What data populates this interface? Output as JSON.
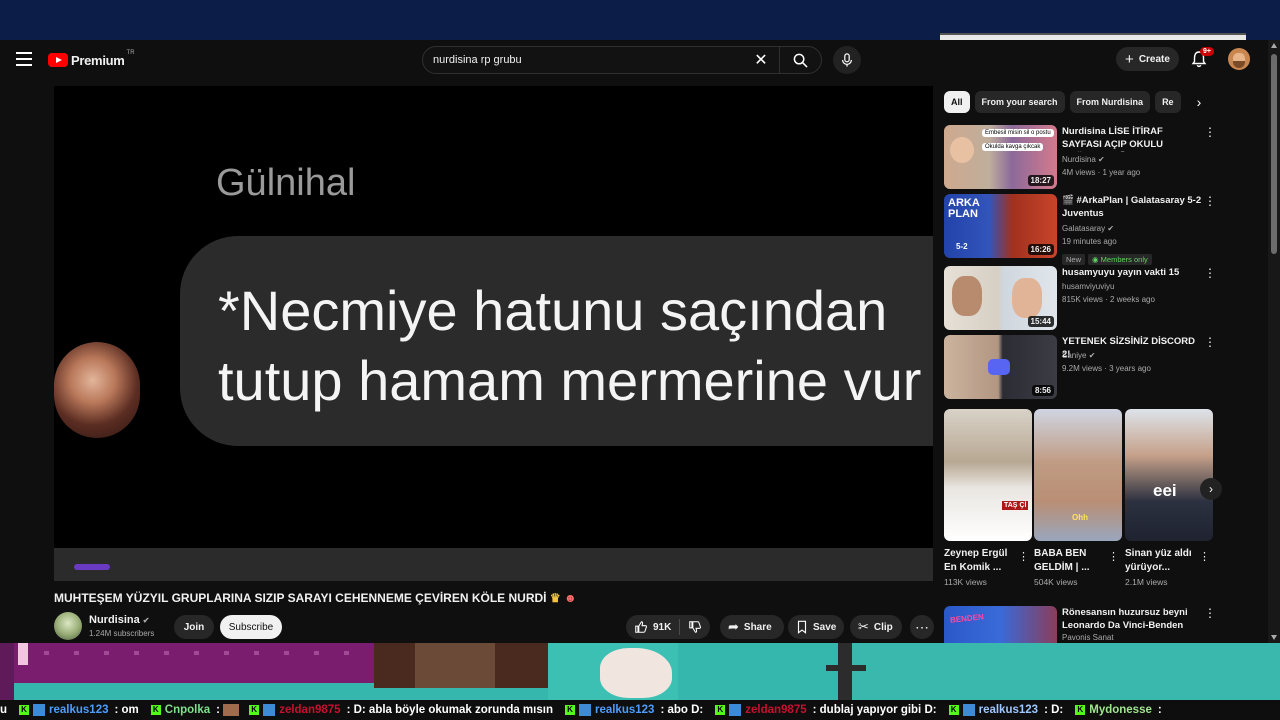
{
  "header": {
    "logo_word": "Premium",
    "logo_country": "TR",
    "search_value": "nurdisina rp grubu",
    "create_label": "Create",
    "notif_badge": "9+"
  },
  "video": {
    "sender_name": "Gülnihal",
    "message_line1": "*Necmiye hatunu saçından",
    "message_line2": "tutup hamam mermerine vur",
    "title": "MUHTEŞEM YÜZYIL GRUPLARINA SIZIP SARAYI CEHENNEME ÇEVİREN KÖLE NURDİ",
    "channel_name": "Nurdisina",
    "subscribers": "1.24M subscribers",
    "join_label": "Join",
    "subscribe_label": "Subscribe",
    "likes": "91K",
    "share_label": "Share",
    "save_label": "Save",
    "clip_label": "Clip"
  },
  "chips": [
    "All",
    "From your search",
    "From Nurdisina",
    "Re"
  ],
  "recommendations": [
    {
      "title": "Nurdisina LİSE İTİRAF SAYFASI AÇIP OKULU DAĞITIYOR 🗿...",
      "channel": "Nurdisina",
      "meta": "4M views · 1 year ago",
      "duration": "18:27",
      "thumb_text1": "Embesil misin sil o postu",
      "thumb_text2": "Okulda kavga çıkcak"
    },
    {
      "title": "🎬 #ArkaPlan | Galatasaray 5-2 Juventus",
      "channel": "Galatasaray",
      "meta": "19 minutes ago",
      "duration": "16:26",
      "thumb_text1": "ARKA PLAN",
      "thumb_text2": "5-2",
      "tag_new": "New",
      "tag_members": "Members only"
    },
    {
      "title": "husamyuyu yayın vakti 15",
      "channel": "husamviyuviyu",
      "meta": "815K views · 2 weeks ago",
      "duration": "15:44"
    },
    {
      "title": "YETENEK SİZSİNİZ DİSCORD 2!",
      "channel": "Saniye",
      "meta": "9.2M views · 3 years ago",
      "duration": "8:56"
    }
  ],
  "shorts": [
    {
      "title": "Zeynep Ergül En Komik ...",
      "views": "113K views",
      "overlay": "TAŞ Çİ"
    },
    {
      "title": "BABA BEN GELDİM | ...",
      "views": "504K views",
      "overlay": "Ohh"
    },
    {
      "title": "Sinan yüz aldı yürüyor...",
      "views": "2.1M views",
      "overlay": "eei"
    }
  ],
  "last_rec": {
    "title": "Rönesansın huzursuz beyni Leonardo Da Vinci-Benden Dinle",
    "channel": "Pavonis Sanat",
    "thumb_text": "BENDEN"
  },
  "chat": [
    {
      "user": "u",
      "text": "",
      "cls": "txt"
    },
    {
      "user": "realkus123",
      "text": "om",
      "cls": "u-blue"
    },
    {
      "user": "Cnpolka",
      "text": "",
      "cls": "u-green"
    },
    {
      "user": "zeldan9875",
      "text": "D: abla böyle okumak zorunda mısın",
      "cls": "u-red"
    },
    {
      "user": "realkus123",
      "text": "abo D:",
      "cls": "u-blue"
    },
    {
      "user": "zeldan9875",
      "text": "dublaj yapıyor gibi D:",
      "cls": "u-red"
    },
    {
      "user": "realkus123",
      "text": "D:",
      "cls": "u-cyan"
    },
    {
      "user": "Mydonesse",
      "text": "",
      "cls": "u-ltgreen"
    }
  ],
  "colors": {
    "brand_red": "#ff0000",
    "background": "#0f0f0f",
    "members_green": "#5fd35f",
    "kick_green": "#53fc18"
  }
}
